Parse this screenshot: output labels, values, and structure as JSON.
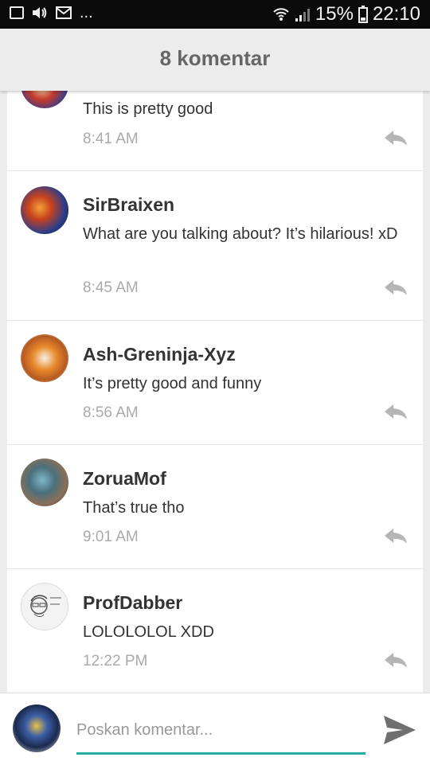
{
  "status_bar": {
    "dots": "...",
    "battery": "15%",
    "time": "22:10"
  },
  "header": {
    "title": "8 komentar"
  },
  "comments": [
    {
      "author": "",
      "text": "This is pretty good",
      "time": "8:41 AM"
    },
    {
      "author": "SirBraixen",
      "text": "What are you talking about? It’s hilarious! xD",
      "time": "8:45 AM"
    },
    {
      "author": "Ash-Greninja-Xyz",
      "text": "It’s pretty good and funny",
      "time": "8:56 AM"
    },
    {
      "author": "ZoruaMof",
      "text": "That’s true tho",
      "time": "9:01 AM"
    },
    {
      "author": "ProfDabber",
      "text": "LOLOLOLOL XDD",
      "time": "12:22 PM"
    }
  ],
  "composer": {
    "placeholder": "Poskan komentar..."
  },
  "colors": {
    "accent": "#2aa9a9",
    "muted": "#aaaaaa",
    "text": "#333333"
  }
}
